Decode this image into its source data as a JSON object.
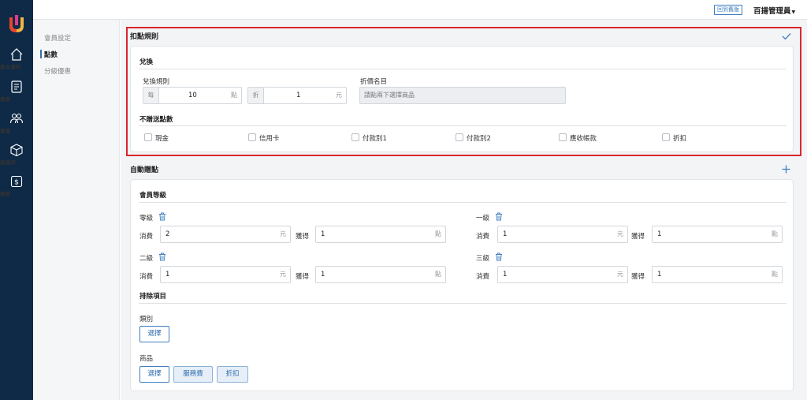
{
  "nav": {
    "items": [
      {
        "label": "基本資料",
        "icon": "home-icon"
      },
      {
        "label": "報表",
        "icon": "report-icon"
      },
      {
        "label": "會員",
        "icon": "members-icon"
      },
      {
        "label": "進銷存",
        "icon": "inventory-icon"
      },
      {
        "label": "帳款",
        "icon": "money-icon"
      }
    ]
  },
  "topbar": {
    "back_label": "回到舊版",
    "user_name": "百揚管理員",
    "caret": "▼"
  },
  "submenu": {
    "items": [
      "會員設定",
      "點數",
      "分級優惠"
    ],
    "active_index": 1
  },
  "deduct": {
    "title": "扣點規則",
    "exchange_title": "兌換",
    "exchange_rule_label": "兌換規則",
    "per_prefix": "每",
    "per_value": "10",
    "per_suffix": "點",
    "discount_prefix": "折",
    "discount_value": "1",
    "discount_suffix": "元",
    "discount_list_label": "折價名目",
    "discount_list_placeholder": "請點兩下選擇商品",
    "no_gift_title": "不贈送點數",
    "no_gift_options": [
      "現金",
      "信用卡",
      "付款別1",
      "付款別2",
      "應收帳款",
      "折扣"
    ]
  },
  "auto": {
    "title": "自動贈點",
    "level_title": "會員等級",
    "spend_label": "消費",
    "earn_label": "獲得",
    "spend_suffix": "元",
    "earn_suffix": "點",
    "levels": [
      {
        "name": "零級",
        "spend": "2",
        "earn": "1"
      },
      {
        "name": "一級",
        "spend": "1",
        "earn": "1"
      },
      {
        "name": "二級",
        "spend": "1",
        "earn": "1"
      },
      {
        "name": "三級",
        "spend": "1",
        "earn": "1"
      }
    ],
    "exclude_title": "排除項目",
    "category_label": "類別",
    "select_label": "選擇",
    "product_label": "商品",
    "product_tags": [
      "服務費",
      "折扣"
    ]
  },
  "colors": {
    "nav_bg": "#0e2a47",
    "accent": "#2f6fb1",
    "highlight": "#d9262e"
  }
}
